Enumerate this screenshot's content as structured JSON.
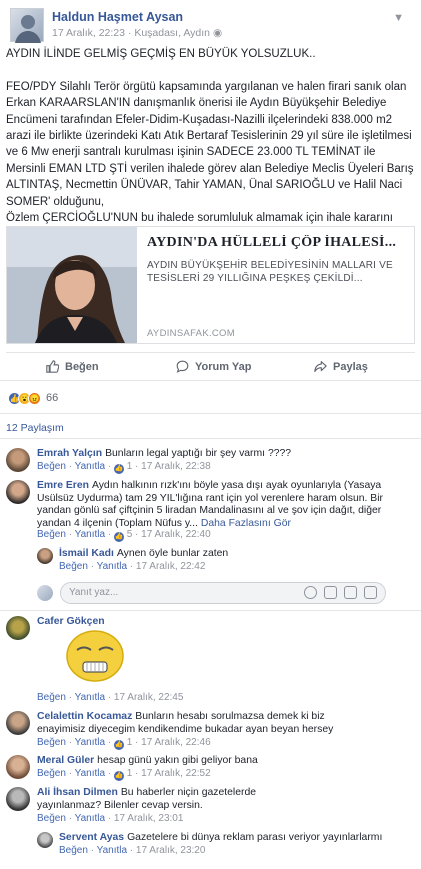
{
  "post": {
    "author": "Haldun Haşmet Aysan",
    "date": "17 Aralık, 22:23",
    "location": "Kuşadası, Aydın",
    "text": "AYDIN İLİNDE GELMİŞ GEÇMİŞ EN BÜYÜK YOLSUZLUK..\n\nFEO/PDY Silahlı Terör örgütü kapsamında yargılanan ve halen firari sanık olan Erkan KARAARSLAN'IN danışmanlık önerisi ile Aydın Büyükşehir Belediye Encümeni tarafından Efeler-Didim-Kuşadası-Nazilli ilçelerindeki 838.000 m2 arazi ile birlikte üzerindeki Katı Atık Bertaraf Tesislerinin 29 yıl süre ile işletilmesi ve 6 Mw enerji santralı kurulması işinin SADECE 23.000 TL TEMİNAT ile Mersinli EMAN LTD ŞTİ verilen ihalede görev alan Belediye Meclis Üyeleri Barış ALTINTAŞ, Necmettin ÜNÜVAR, Tahir YAMAN, Ünal SARIOĞLU ve Halil Naci SOMER' olduğunu,\nÖzlem ÇERCİOĞLU'NUN bu ihalede sorumluluk almamak için ihale kararını onaylamadığı vekaleten EVRİM KARAKOZ'un imzaladığını biliyormuydunuz..?"
  },
  "link_card": {
    "title": "AYDIN'DA HÜLLELİ ÇÖP İHALESİ...",
    "description": "AYDIN BÜYÜKŞEHİR BELEDİYESİNİN MALLARI VE TESİSLERİ 29 YILLIĞINA PEŞKEŞ ÇEKİLDİ...",
    "domain": "AYDINSAFAK.COM"
  },
  "actions": {
    "like": "Beğen",
    "comment": "Yorum Yap",
    "share": "Paylaş"
  },
  "reactions": {
    "count": "66"
  },
  "shares": "12 Paylaşım",
  "labels": {
    "like": "Beğen",
    "reply": "Yanıtla",
    "more": "Daha Fazlasını Gör"
  },
  "reply_placeholder": "Yanıt yaz...",
  "comments": [
    {
      "name": "Emrah Yalçın",
      "text": "Bunların legal yaptığı bir şey varmı ????",
      "likes": "1",
      "time": "17 Aralık, 22:38"
    },
    {
      "name": "Emre Eren",
      "text": "Aydın halkının rızk'ını böyle yasa dışı ayak oyunlarıyla (Yasaya Usülsüz Uydurma) tam 29 YIL'lığına rant için yol verenlere haram olsun. Bir yandan gönlü saf çiftçinin 5 liradan Mandalinasını al ve şov için dağıt, diğer yandan 4 ilçenin (Toplam Nüfus y...",
      "likes": "5",
      "time": "17 Aralık, 22:40"
    },
    {
      "name": "İsmail Kadı",
      "text": "Aynen öyle bunlar zaten",
      "likes": "",
      "time": "17 Aralık, 22:42"
    },
    {
      "name": "Cafer Gökçen",
      "text": "",
      "likes": "",
      "time": "17 Aralık, 22:45"
    },
    {
      "name": "Celalettin Kocamaz",
      "text": "Bunların hesabı sorulmazsa demek ki biz enayimisiz diyecegim kendikendime bukadar ayan beyan hersey",
      "likes": "1",
      "time": "17 Aralık, 22:46"
    },
    {
      "name": "Meral Güler",
      "text": "hesap günü yakın gibi geliyor bana",
      "likes": "1",
      "time": "17 Aralık, 22:52"
    },
    {
      "name": "Ali İhsan Dilmen",
      "text": "Bu haberler niçin gazetelerde yayınlanmaz? Bilenler cevap versin.",
      "likes": "",
      "time": "17 Aralık, 23:01"
    },
    {
      "name": "Servent Ayas",
      "text": "Gazetelere bi dünya reklam parası veriyor yayınlarlarmı",
      "likes": "",
      "time": "17 Aralık, 23:20"
    }
  ],
  "colors": {
    "link_blue": "#385898",
    "name_blue": "#365899",
    "meta_grey": "#90949c",
    "like_blue": "#4267b2"
  }
}
